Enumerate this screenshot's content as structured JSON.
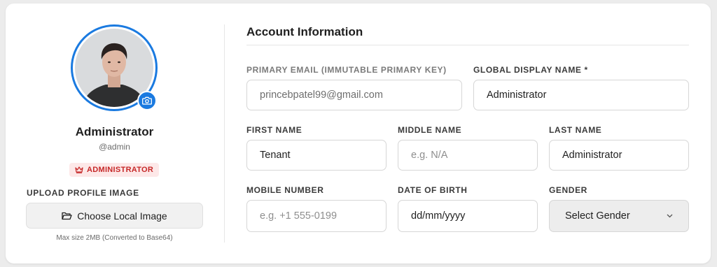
{
  "profile": {
    "name": "Administrator",
    "handle": "@admin",
    "role": "ADMINISTRATOR",
    "upload_label": "UPLOAD PROFILE IMAGE",
    "upload_button": "Choose Local Image",
    "upload_hint": "Max size 2MB (Converted to Base64)",
    "icons": {
      "camera": "camera-icon",
      "crown": "crown-icon",
      "folder": "folder-open-icon"
    }
  },
  "form": {
    "title": "Account Information",
    "primary_email": {
      "label": "PRIMARY EMAIL (IMMUTABLE PRIMARY KEY)",
      "value": "princebpatel99@gmail.com"
    },
    "display_name": {
      "label": "GLOBAL DISPLAY NAME *",
      "value": "Administrator"
    },
    "first_name": {
      "label": "FIRST NAME",
      "value": "Tenant"
    },
    "middle_name": {
      "label": "MIDDLE NAME",
      "value": "",
      "placeholder": "e.g. N/A"
    },
    "last_name": {
      "label": "LAST NAME",
      "value": "Administrator"
    },
    "mobile": {
      "label": "MOBILE NUMBER",
      "value": "",
      "placeholder": "e.g. +1 555-0199"
    },
    "dob": {
      "label": "DATE OF BIRTH",
      "value": "dd/mm/yyyy"
    },
    "gender": {
      "label": "GENDER",
      "selected": "Select Gender"
    }
  },
  "colors": {
    "accent": "#1a7ae0",
    "badge_bg": "#fde8e8",
    "badge_text": "#c62828"
  }
}
